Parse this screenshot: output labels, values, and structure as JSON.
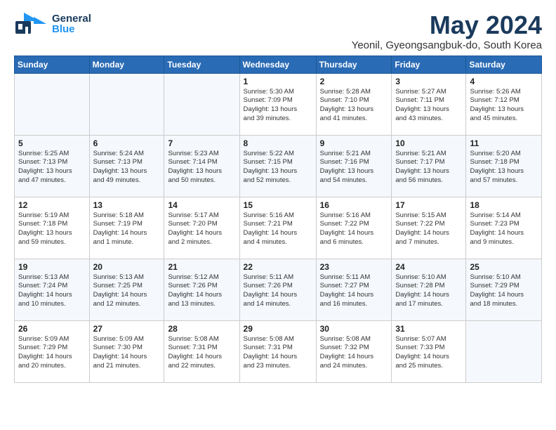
{
  "header": {
    "logo_general": "General",
    "logo_blue": "Blue",
    "month_year": "May 2024",
    "location": "Yeonil, Gyeongsangbuk-do, South Korea"
  },
  "weekdays": [
    "Sunday",
    "Monday",
    "Tuesday",
    "Wednesday",
    "Thursday",
    "Friday",
    "Saturday"
  ],
  "weeks": [
    [
      {
        "day": "",
        "detail": ""
      },
      {
        "day": "",
        "detail": ""
      },
      {
        "day": "",
        "detail": ""
      },
      {
        "day": "1",
        "detail": "Sunrise: 5:30 AM\nSunset: 7:09 PM\nDaylight: 13 hours\nand 39 minutes."
      },
      {
        "day": "2",
        "detail": "Sunrise: 5:28 AM\nSunset: 7:10 PM\nDaylight: 13 hours\nand 41 minutes."
      },
      {
        "day": "3",
        "detail": "Sunrise: 5:27 AM\nSunset: 7:11 PM\nDaylight: 13 hours\nand 43 minutes."
      },
      {
        "day": "4",
        "detail": "Sunrise: 5:26 AM\nSunset: 7:12 PM\nDaylight: 13 hours\nand 45 minutes."
      }
    ],
    [
      {
        "day": "5",
        "detail": "Sunrise: 5:25 AM\nSunset: 7:13 PM\nDaylight: 13 hours\nand 47 minutes."
      },
      {
        "day": "6",
        "detail": "Sunrise: 5:24 AM\nSunset: 7:13 PM\nDaylight: 13 hours\nand 49 minutes."
      },
      {
        "day": "7",
        "detail": "Sunrise: 5:23 AM\nSunset: 7:14 PM\nDaylight: 13 hours\nand 50 minutes."
      },
      {
        "day": "8",
        "detail": "Sunrise: 5:22 AM\nSunset: 7:15 PM\nDaylight: 13 hours\nand 52 minutes."
      },
      {
        "day": "9",
        "detail": "Sunrise: 5:21 AM\nSunset: 7:16 PM\nDaylight: 13 hours\nand 54 minutes."
      },
      {
        "day": "10",
        "detail": "Sunrise: 5:21 AM\nSunset: 7:17 PM\nDaylight: 13 hours\nand 56 minutes."
      },
      {
        "day": "11",
        "detail": "Sunrise: 5:20 AM\nSunset: 7:18 PM\nDaylight: 13 hours\nand 57 minutes."
      }
    ],
    [
      {
        "day": "12",
        "detail": "Sunrise: 5:19 AM\nSunset: 7:18 PM\nDaylight: 13 hours\nand 59 minutes."
      },
      {
        "day": "13",
        "detail": "Sunrise: 5:18 AM\nSunset: 7:19 PM\nDaylight: 14 hours\nand 1 minute."
      },
      {
        "day": "14",
        "detail": "Sunrise: 5:17 AM\nSunset: 7:20 PM\nDaylight: 14 hours\nand 2 minutes."
      },
      {
        "day": "15",
        "detail": "Sunrise: 5:16 AM\nSunset: 7:21 PM\nDaylight: 14 hours\nand 4 minutes."
      },
      {
        "day": "16",
        "detail": "Sunrise: 5:16 AM\nSunset: 7:22 PM\nDaylight: 14 hours\nand 6 minutes."
      },
      {
        "day": "17",
        "detail": "Sunrise: 5:15 AM\nSunset: 7:22 PM\nDaylight: 14 hours\nand 7 minutes."
      },
      {
        "day": "18",
        "detail": "Sunrise: 5:14 AM\nSunset: 7:23 PM\nDaylight: 14 hours\nand 9 minutes."
      }
    ],
    [
      {
        "day": "19",
        "detail": "Sunrise: 5:13 AM\nSunset: 7:24 PM\nDaylight: 14 hours\nand 10 minutes."
      },
      {
        "day": "20",
        "detail": "Sunrise: 5:13 AM\nSunset: 7:25 PM\nDaylight: 14 hours\nand 12 minutes."
      },
      {
        "day": "21",
        "detail": "Sunrise: 5:12 AM\nSunset: 7:26 PM\nDaylight: 14 hours\nand 13 minutes."
      },
      {
        "day": "22",
        "detail": "Sunrise: 5:11 AM\nSunset: 7:26 PM\nDaylight: 14 hours\nand 14 minutes."
      },
      {
        "day": "23",
        "detail": "Sunrise: 5:11 AM\nSunset: 7:27 PM\nDaylight: 14 hours\nand 16 minutes."
      },
      {
        "day": "24",
        "detail": "Sunrise: 5:10 AM\nSunset: 7:28 PM\nDaylight: 14 hours\nand 17 minutes."
      },
      {
        "day": "25",
        "detail": "Sunrise: 5:10 AM\nSunset: 7:29 PM\nDaylight: 14 hours\nand 18 minutes."
      }
    ],
    [
      {
        "day": "26",
        "detail": "Sunrise: 5:09 AM\nSunset: 7:29 PM\nDaylight: 14 hours\nand 20 minutes."
      },
      {
        "day": "27",
        "detail": "Sunrise: 5:09 AM\nSunset: 7:30 PM\nDaylight: 14 hours\nand 21 minutes."
      },
      {
        "day": "28",
        "detail": "Sunrise: 5:08 AM\nSunset: 7:31 PM\nDaylight: 14 hours\nand 22 minutes."
      },
      {
        "day": "29",
        "detail": "Sunrise: 5:08 AM\nSunset: 7:31 PM\nDaylight: 14 hours\nand 23 minutes."
      },
      {
        "day": "30",
        "detail": "Sunrise: 5:08 AM\nSunset: 7:32 PM\nDaylight: 14 hours\nand 24 minutes."
      },
      {
        "day": "31",
        "detail": "Sunrise: 5:07 AM\nSunset: 7:33 PM\nDaylight: 14 hours\nand 25 minutes."
      },
      {
        "day": "",
        "detail": ""
      }
    ]
  ]
}
